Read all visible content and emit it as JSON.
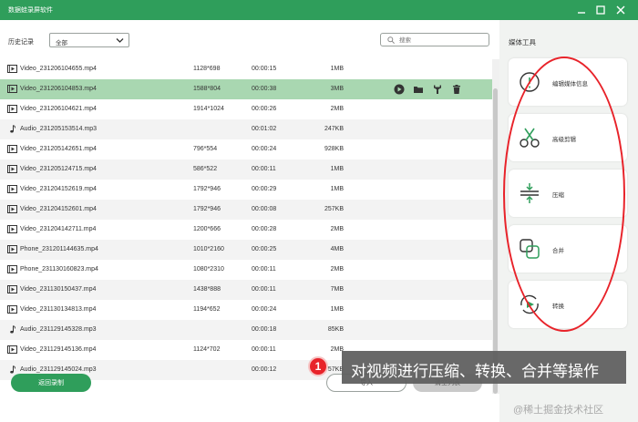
{
  "window": {
    "title": "数据蛙录屏软件",
    "controls": [
      {
        "name": "minimize-button",
        "icon": "minimize-icon"
      },
      {
        "name": "maximize-button",
        "icon": "maximize-icon"
      },
      {
        "name": "close-button",
        "icon": "close-icon"
      }
    ]
  },
  "toolbar": {
    "history_label": "历史记录",
    "filter_value": "全部",
    "search_placeholder": "搜索"
  },
  "files": [
    {
      "type": "video",
      "name": "Video_231206104655.mp4",
      "resolution": "1128*698",
      "duration": "00:00:15",
      "size": "1MB"
    },
    {
      "type": "video",
      "name": "Video_231206104853.mp4",
      "resolution": "1588*804",
      "duration": "00:00:38",
      "size": "3MB",
      "selected": true
    },
    {
      "type": "video",
      "name": "Video_231206104621.mp4",
      "resolution": "1914*1024",
      "duration": "00:00:26",
      "size": "2MB"
    },
    {
      "type": "audio",
      "name": "Audio_231205153514.mp3",
      "resolution": "",
      "duration": "00:01:02",
      "size": "247KB"
    },
    {
      "type": "video",
      "name": "Video_231205142651.mp4",
      "resolution": "796*554",
      "duration": "00:00:24",
      "size": "928KB"
    },
    {
      "type": "video",
      "name": "Video_231205124715.mp4",
      "resolution": "586*522",
      "duration": "00:00:11",
      "size": "1MB"
    },
    {
      "type": "video",
      "name": "Video_231204152619.mp4",
      "resolution": "1792*946",
      "duration": "00:00:29",
      "size": "1MB"
    },
    {
      "type": "video",
      "name": "Video_231204152601.mp4",
      "resolution": "1792*946",
      "duration": "00:00:08",
      "size": "257KB"
    },
    {
      "type": "video",
      "name": "Video_231204142711.mp4",
      "resolution": "1200*666",
      "duration": "00:00:28",
      "size": "2MB"
    },
    {
      "type": "video",
      "name": "Phone_231201144635.mp4",
      "resolution": "1010*2160",
      "duration": "00:00:25",
      "size": "4MB"
    },
    {
      "type": "video",
      "name": "Phone_231130160823.mp4",
      "resolution": "1080*2310",
      "duration": "00:00:11",
      "size": "2MB"
    },
    {
      "type": "video",
      "name": "Video_231130150437.mp4",
      "resolution": "1438*888",
      "duration": "00:00:11",
      "size": "7MB"
    },
    {
      "type": "video",
      "name": "Video_231130134813.mp4",
      "resolution": "1194*652",
      "duration": "00:00:24",
      "size": "1MB"
    },
    {
      "type": "audio",
      "name": "Audio_231129145328.mp3",
      "resolution": "",
      "duration": "00:00:18",
      "size": "85KB"
    },
    {
      "type": "video",
      "name": "Video_231129145136.mp4",
      "resolution": "1124*702",
      "duration": "00:00:11",
      "size": "2MB"
    },
    {
      "type": "audio",
      "name": "Audio_231129145024.mp3",
      "resolution": "",
      "duration": "00:00:12",
      "size": "57KB"
    }
  ],
  "row_actions": [
    "play-icon",
    "folder-icon",
    "tools-icon",
    "trash-icon"
  ],
  "buttons": {
    "back": "返回录制",
    "import": "导入",
    "clear": "清空列表"
  },
  "media_tools": {
    "title": "媒体工具",
    "items": [
      {
        "label": "编辑媒体信息",
        "icon": "info-icon"
      },
      {
        "label": "高级剪辑",
        "icon": "scissors-icon"
      },
      {
        "label": "压缩",
        "icon": "compress-icon"
      },
      {
        "label": "合并",
        "icon": "merge-icon"
      },
      {
        "label": "转换",
        "icon": "convert-icon"
      }
    ]
  },
  "annotation": {
    "badge": "1",
    "text": "对视频进行压缩、转换、合并等操作",
    "highlight_color": "#e8232a"
  },
  "watermark": "@稀土掘金技术社区",
  "colors": {
    "brand": "#2f9e5b",
    "selected_row": "#a9d7b1"
  }
}
